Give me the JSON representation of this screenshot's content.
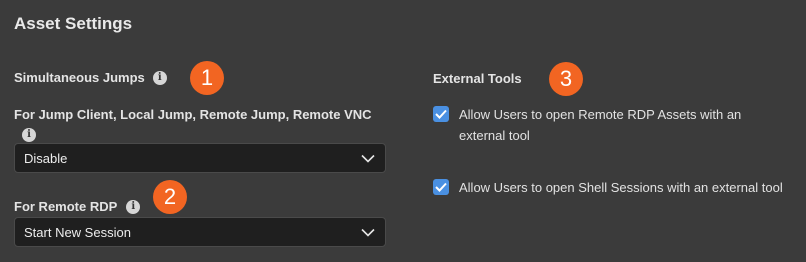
{
  "page": {
    "title": "Asset Settings"
  },
  "simultaneous_jumps": {
    "label": "Simultaneous Jumps",
    "badge": "1",
    "jump_client": {
      "label": "For Jump Client, Local Jump, Remote Jump, Remote VNC",
      "selected": "Disable"
    },
    "remote_rdp": {
      "label": "For Remote RDP",
      "badge": "2",
      "selected": "Start New Session"
    }
  },
  "external_tools": {
    "label": "External Tools",
    "badge": "3",
    "options": [
      {
        "label": "Allow Users to open Remote RDP Assets with an external tool",
        "checked": true
      },
      {
        "label": "Allow Users to open Shell Sessions with an external tool",
        "checked": true
      }
    ]
  },
  "colors": {
    "background": "#3b3b3b",
    "badge": "#f26522",
    "checkbox": "#4a90e2",
    "select_bg": "#1f1f1f"
  },
  "icons": [
    "info-icon",
    "chevron-down-icon",
    "checkmark-icon"
  ]
}
